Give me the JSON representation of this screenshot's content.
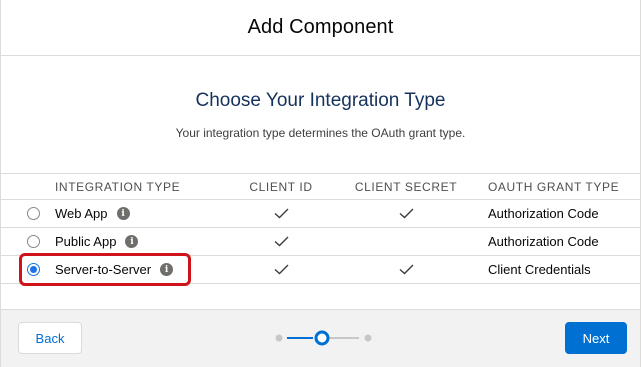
{
  "modal": {
    "title": "Add Component"
  },
  "section": {
    "heading": "Choose Your Integration Type",
    "subheading": "Your integration type determines the OAuth grant type."
  },
  "table": {
    "columns": [
      "INTEGRATION TYPE",
      "CLIENT ID",
      "CLIENT SECRET",
      "OAUTH GRANT TYPE"
    ],
    "rows": [
      {
        "type": "Web App",
        "client_id": true,
        "client_secret": true,
        "grant": "Authorization Code",
        "selected": false
      },
      {
        "type": "Public App",
        "client_id": true,
        "client_secret": false,
        "grant": "Authorization Code",
        "selected": false
      },
      {
        "type": "Server-to-Server",
        "client_id": true,
        "client_secret": true,
        "grant": "Client Credentials",
        "selected": true
      }
    ]
  },
  "footer": {
    "back_label": "Back",
    "next_label": "Next",
    "progress": {
      "steps": 3,
      "current_step": 2
    }
  },
  "colors": {
    "brand": "#0070d2",
    "highlight": "#d0131a",
    "radio_selected": "#1a73e8"
  },
  "icons": {
    "info": "info-icon",
    "check": "check-icon"
  }
}
